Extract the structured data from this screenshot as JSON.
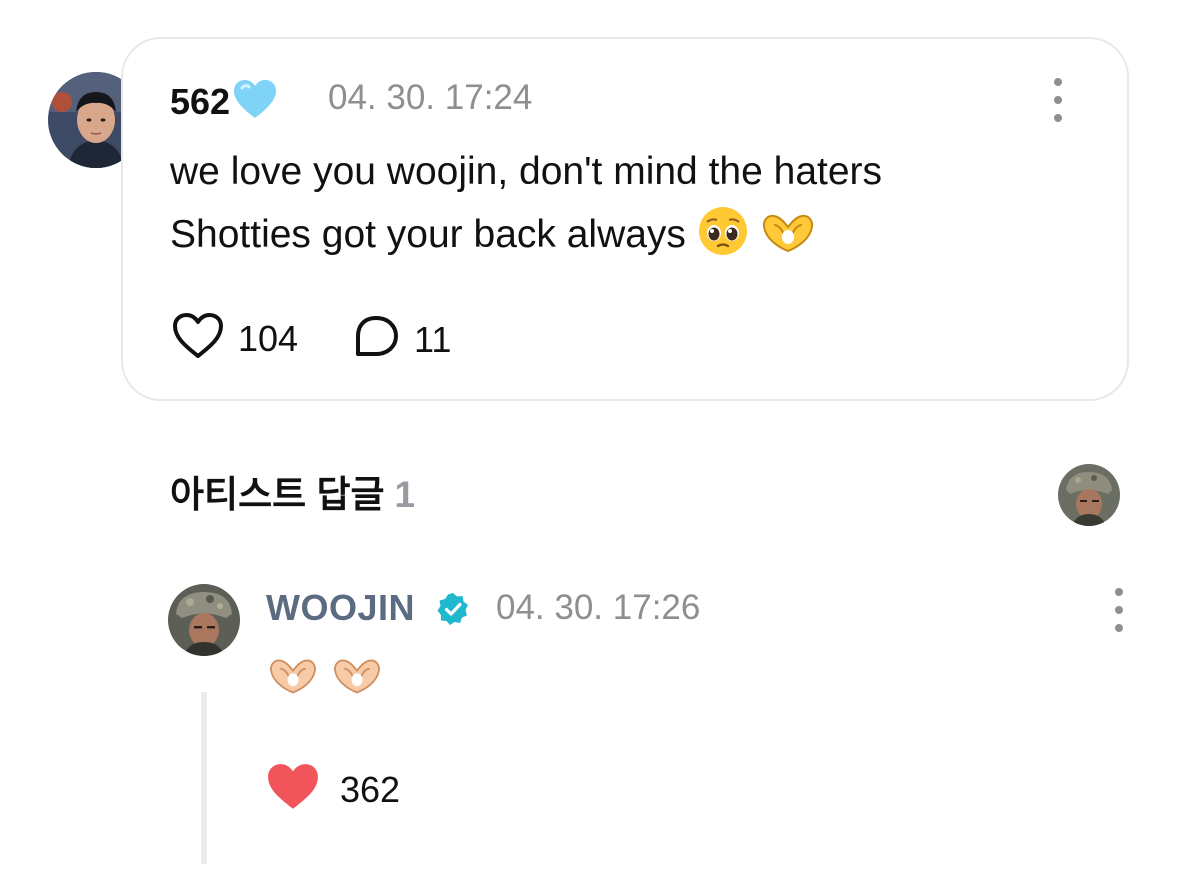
{
  "comment": {
    "author": "562",
    "author_badge_icon": "light-blue-heart-emoji",
    "timestamp": "04. 30. 17:24",
    "text_line1": "we love you woojin, don't mind the haters",
    "text_line2": "Shotties got your back always",
    "trailing_emojis": [
      "pleading-face-emoji",
      "heart-hands-emoji"
    ],
    "likes": "104",
    "replies": "11"
  },
  "artist_replies": {
    "title": "아티스트 답글",
    "count": "1",
    "reply": {
      "author": "WOOJIN",
      "verified_icon": "verified-badge-icon",
      "timestamp": "04. 30. 17:26",
      "emojis": [
        "heart-hands-emoji",
        "heart-hands-emoji"
      ],
      "likes": "362",
      "liked": true
    }
  },
  "colors": {
    "card_border": "#e8e8ec",
    "muted_text": "#8e8e93",
    "artist_name": "#5b6b82",
    "verified": "#1fb8cf",
    "liked_heart": "#f2545b",
    "thread_line": "#ececf0"
  }
}
